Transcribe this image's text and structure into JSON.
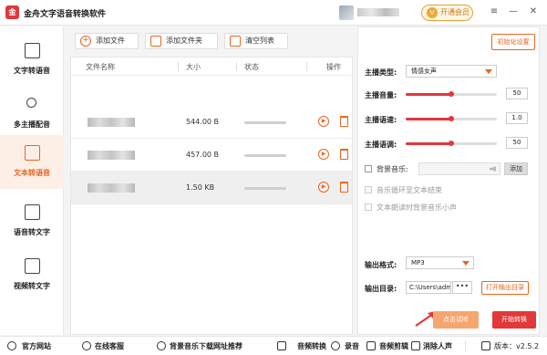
{
  "app": {
    "logo": "金",
    "title": "金舟文字语音转换软件",
    "vip_label": "开通会员",
    "vip_icon": "V"
  },
  "window_controls": [
    "≡",
    "—",
    "✕"
  ],
  "sidebar": {
    "items": [
      {
        "label": "文字转语音",
        "icon": "text-to-speech-icon"
      },
      {
        "label": "多主播配音",
        "icon": "person-plus-icon"
      },
      {
        "label": "文本转语音",
        "icon": "document-text-icon",
        "active": true
      },
      {
        "label": "语音转文字",
        "icon": "speech-to-text-icon"
      },
      {
        "label": "视频转文字",
        "icon": "video-to-text-icon"
      }
    ]
  },
  "toolbar": {
    "add_file": "添加文件",
    "add_folder": "添加文件夹",
    "clear_list": "清空列表"
  },
  "table": {
    "headers": {
      "name": "文件名称",
      "size": "大小",
      "status": "状态",
      "action": "操作"
    },
    "rows": [
      {
        "size": "544.00 B"
      },
      {
        "size": "457.00 B"
      },
      {
        "size": "1.50 KB"
      }
    ]
  },
  "settings": {
    "reset_label": "初始化设置",
    "anchor_type_label": "主播类型:",
    "anchor_type_value": "情感女声",
    "volume_label": "主播音量:",
    "volume_value": "50",
    "volume_level": 0.5,
    "speed_label": "主播语速:",
    "speed_value": "1.0",
    "speed_level": 0.5,
    "pitch_label": "主播语调:",
    "pitch_value": "50",
    "pitch_level": 0.5,
    "bg_music_label": "背景音乐:",
    "add_label": "添加",
    "loop_label": "音乐循环至文本结束",
    "lower_bg_label": "文本朗读时背景音乐小声",
    "format_label": "输出格式:",
    "format_value": "MP3",
    "dir_label": "输出目录:",
    "dir_value": "C:\\Users\\admir",
    "dots": "•••",
    "open_dir_label": "打开输出目录",
    "trial_label": "点击试听",
    "start_label": "开始转换"
  },
  "footer": {
    "website": "官方网站",
    "service": "在线客服",
    "bg_music_link": "背景音乐下载网址推荐",
    "audio_convert": "音频转换",
    "record": "录音",
    "audio_cut": "音频剪辑",
    "vocal_remove": "消除人声",
    "version": "版本：v2.5.2"
  },
  "colors": {
    "accent": "#e8661e",
    "primary_red": "#e2383a"
  }
}
